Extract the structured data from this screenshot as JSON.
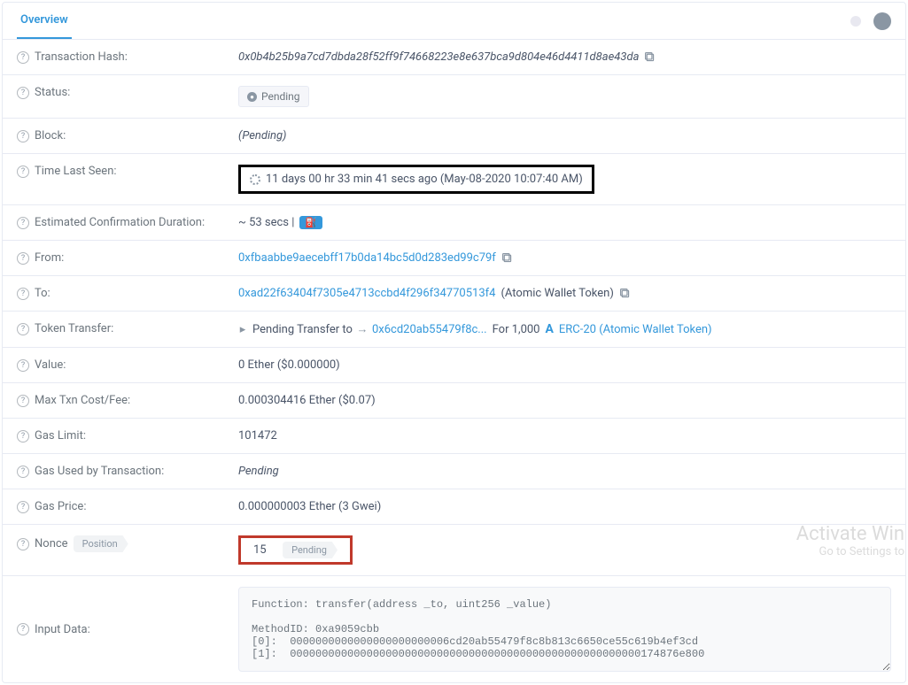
{
  "tabs": {
    "overview": "Overview"
  },
  "labels": {
    "txn_hash": "Transaction Hash:",
    "status": "Status:",
    "block": "Block:",
    "time_last_seen": "Time Last Seen:",
    "est_conf": "Estimated Confirmation Duration:",
    "from": "From:",
    "to": "To:",
    "token_transfer": "Token Transfer:",
    "value": "Value:",
    "max_txn": "Max Txn Cost/Fee:",
    "gas_limit": "Gas Limit:",
    "gas_used": "Gas Used by Transaction:",
    "gas_price": "Gas Price:",
    "nonce": "Nonce",
    "position_pill": "Position",
    "input_data": "Input Data:"
  },
  "values": {
    "txn_hash": "0x0b4b25b9a7cd7dbda28f52ff9f74668223e8e637bca9d804e46d4411d8ae43da",
    "status_pending": "Pending",
    "block": "(Pending)",
    "time_last_seen": "11 days 00 hr 33 min 41 secs ago (May-08-2020 10:07:40 AM)",
    "est_conf_text": "~ 53 secs |",
    "from": "0xfbaabbe9aecebff17b0da14bc5d0d283ed99c79f",
    "to_addr": "0xad22f63404f7305e4713ccbd4f296f34770513f4",
    "to_name": "(Atomic Wallet Token)",
    "transfer_prefix": "Pending Transfer to",
    "transfer_addr": "0x6cd20ab55479f8c...",
    "transfer_for": "For 1,000",
    "erc20": "ERC-20 (Atomic Wallet Token)",
    "value": "0 Ether ($0.000000)",
    "max_txn": "0.000304416 Ether ($0.07)",
    "gas_limit": "101472",
    "gas_used": "Pending",
    "gas_price": "0.000000003 Ether (3 Gwei)",
    "nonce": "15",
    "nonce_pending": "Pending",
    "input_data": "Function: transfer(address _to, uint256 _value)\n\nMethodID: 0xa9059cbb\n[0]:  0000000000000000000000006cd20ab55479f8c8b813c6650ce55c619b4ef3cd\n[1]:  0000000000000000000000000000000000000000000000000000000174876e800"
  },
  "watermark": {
    "line1": "Activate Win",
    "line2": "Go to Settings to"
  }
}
